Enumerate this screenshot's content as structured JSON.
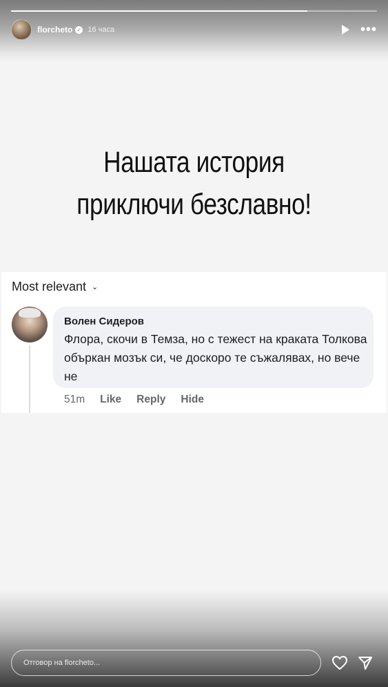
{
  "story": {
    "username": "florcheto",
    "time": "16 часа",
    "progress": 0.81,
    "headline_line1": "Нашата история",
    "headline_line2": "приключи безславно!"
  },
  "comments": {
    "sort_label": "Most relevant",
    "items": [
      {
        "author": "Волен Сидеров",
        "text": "Флора, скочи в Темза, но с тежест на краката Толкова объркан мозък си, че доскоро те съжалявах, но вече не",
        "time": "51m",
        "like": "Like",
        "reply": "Reply",
        "hide": "Hide"
      }
    ]
  },
  "footer": {
    "reply_placeholder": "Отговор на florcheto..."
  },
  "icons": [
    "play-icon",
    "more-icon",
    "verified-icon",
    "chevron-down-icon",
    "heart-icon",
    "send-icon"
  ]
}
